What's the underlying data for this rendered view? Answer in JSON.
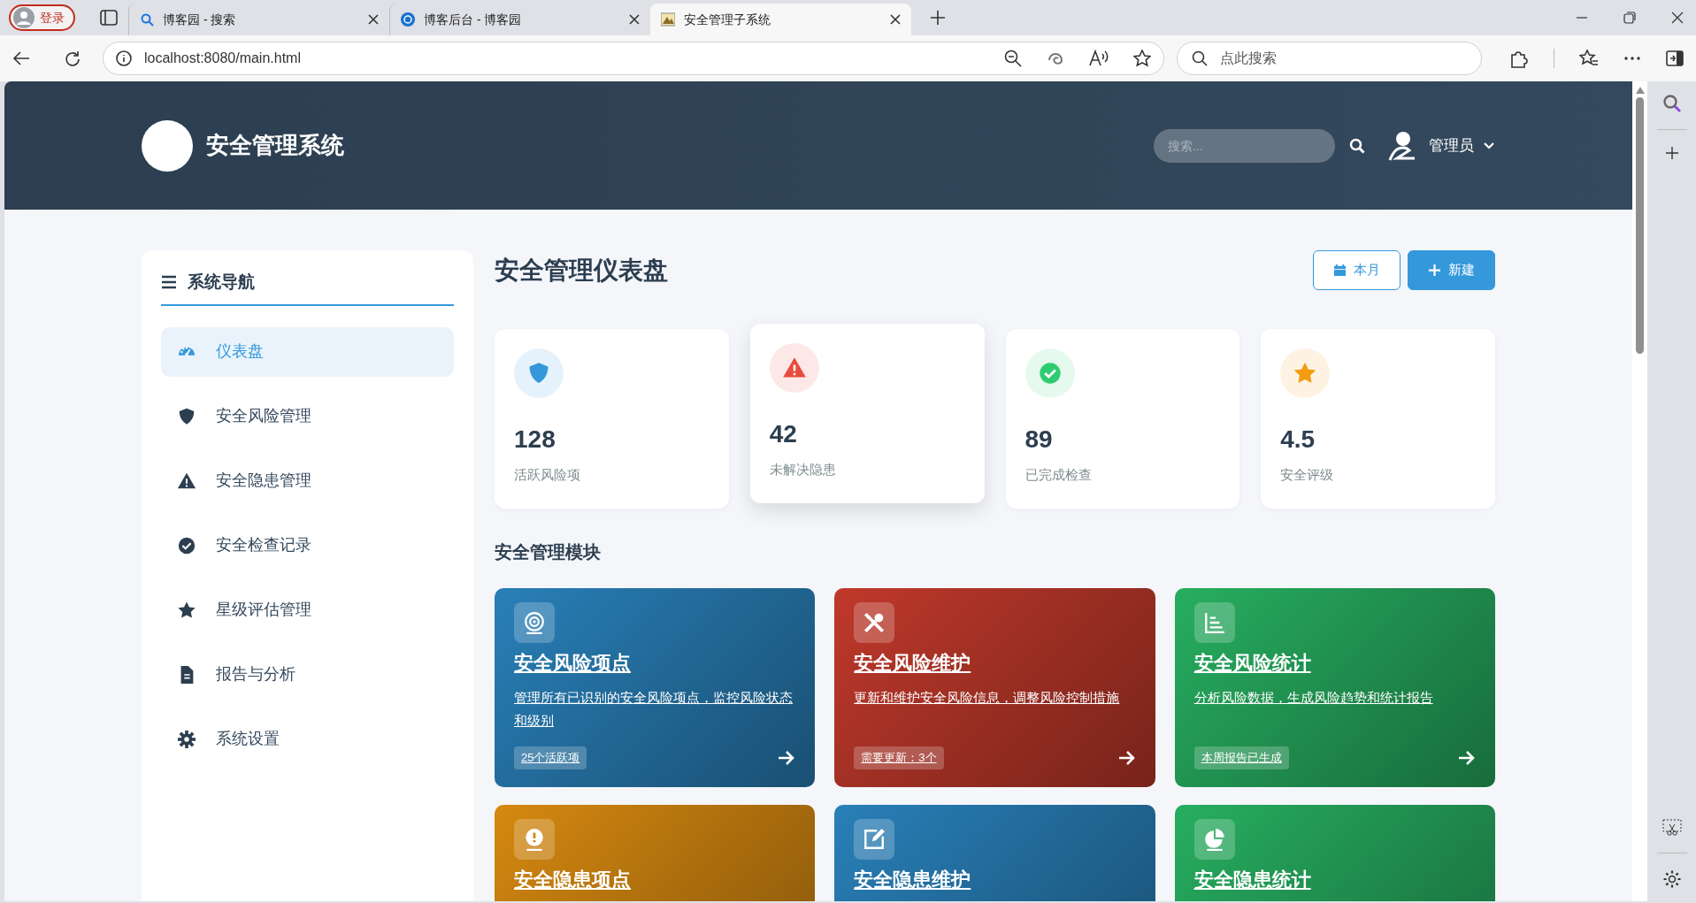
{
  "browser": {
    "profile": "登录",
    "tabs": [
      {
        "title": "博客园 - 搜索",
        "selected": false
      },
      {
        "title": "博客后台 - 博客园",
        "selected": false
      },
      {
        "title": "安全管理子系统",
        "selected": true
      }
    ],
    "address": "localhost:8080/main.html",
    "search_placeholder": "点此搜索"
  },
  "header": {
    "title": "安全管理系统",
    "search_placeholder": "搜索...",
    "user": "管理员"
  },
  "sidebar": {
    "title": "系统导航",
    "items": [
      {
        "label": "仪表盘",
        "selected": true
      },
      {
        "label": "安全风险管理",
        "selected": false
      },
      {
        "label": "安全隐患管理",
        "selected": false
      },
      {
        "label": "安全检查记录",
        "selected": false
      },
      {
        "label": "星级评估管理",
        "selected": false
      },
      {
        "label": "报告与分析",
        "selected": false
      },
      {
        "label": "系统设置",
        "selected": false
      }
    ]
  },
  "dashboard": {
    "title": "安全管理仪表盘",
    "buttons": [
      {
        "label": "本月",
        "kind": "outline"
      },
      {
        "label": "新建",
        "kind": "primary"
      }
    ],
    "stats": [
      {
        "value": "128",
        "label": "活跃风险项",
        "color": "#3498db",
        "hovered": false
      },
      {
        "value": "42",
        "label": "未解决隐患",
        "color": "#e74c3c",
        "hovered": true
      },
      {
        "value": "89",
        "label": "已完成检查",
        "color": "#2ecc71",
        "hovered": false
      },
      {
        "value": "4.5",
        "label": "安全评级",
        "color": "#f39c12",
        "hovered": false
      }
    ],
    "section_title": "安全管理模块",
    "modules": [
      {
        "title": "安全风险项点",
        "description": "管理所有已识别的安全风险项点，监控风险状态和级别",
        "badge": "25个活跃项",
        "color": "#2980b9"
      },
      {
        "title": "安全风险维护",
        "description": "更新和维护安全风险信息，调整风险控制措施",
        "badge": "需要更新：3个",
        "color": "#c0392b"
      },
      {
        "title": "安全风险统计",
        "description": "分析风险数据，生成风险趋势和统计报告",
        "badge": "本周报告已生成",
        "color": "#27ae60"
      },
      {
        "title": "安全隐患项点",
        "color": "#d68910"
      },
      {
        "title": "安全隐患维护",
        "color": "#2980b9"
      },
      {
        "title": "安全隐患统计",
        "color": "#27ae60"
      }
    ]
  }
}
